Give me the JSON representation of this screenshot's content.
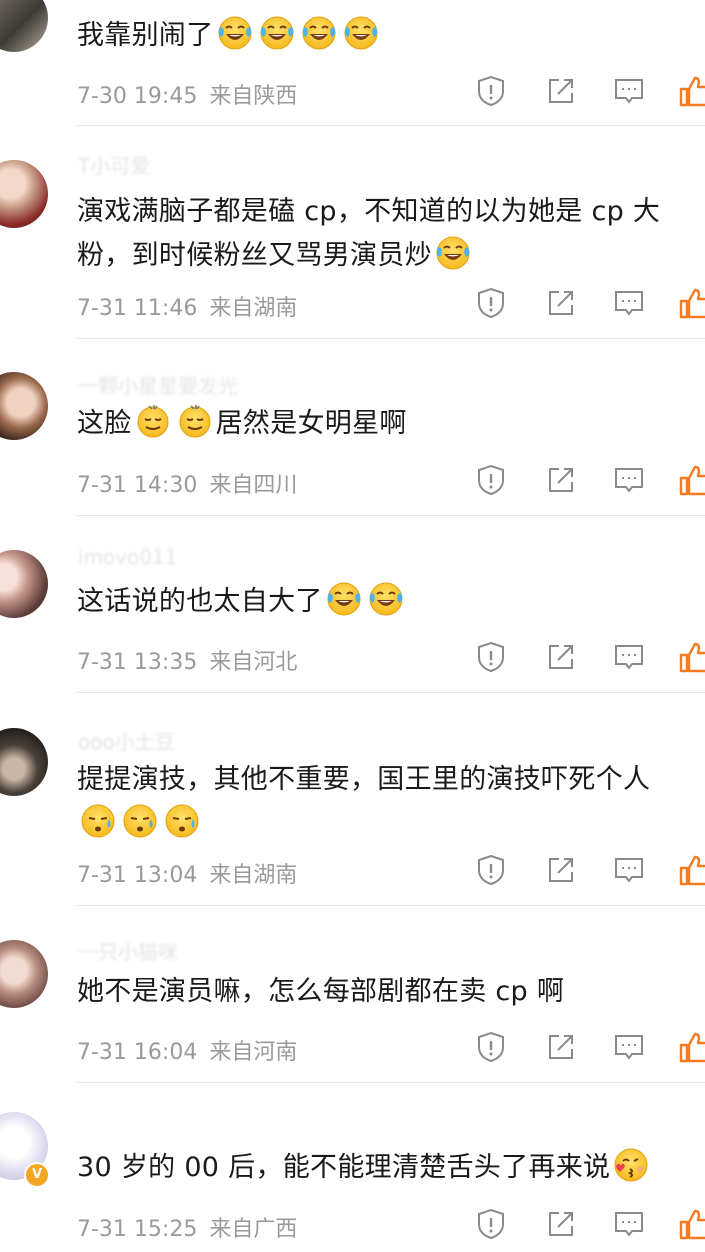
{
  "comments": [
    {
      "username": "",
      "text": "我靠别闹了",
      "emojis_after": [
        "laugh-cry",
        "laugh-cry",
        "laugh-cry",
        "laugh-cry"
      ],
      "date": "7-30 19:45",
      "location": "来自陕西"
    },
    {
      "username": "T小可爱",
      "text1": "演戏满脑子都是磕 cp，不知道的以为她是 cp 大",
      "text2": "粉，到时候粉丝又骂男演员炒",
      "emojis_after": [
        "laugh-cry"
      ],
      "date": "7-31 11:46",
      "location": "来自湖南"
    },
    {
      "username": "一颗小星星要发光",
      "text_before": "这脸",
      "emojis_mid": [
        "dizzy",
        "dizzy"
      ],
      "text_after": "居然是女明星啊",
      "date": "7-31 14:30",
      "location": "来自四川"
    },
    {
      "username": "imovo011",
      "text": "这话说的也太自大了",
      "emojis_after": [
        "laugh-cry",
        "laugh-cry"
      ],
      "date": "7-31 13:35",
      "location": "来自河北"
    },
    {
      "username": "ooo小土豆",
      "text1": "提提演技，其他不重要，国王里的演技吓死个人",
      "emojis_line2": [
        "sweat",
        "sweat",
        "sweat"
      ],
      "date": "7-31 13:04",
      "location": "来自湖南"
    },
    {
      "username": "一只小猫咪",
      "text": "她不是演员嘛，怎么每部剧都在卖 cp 啊",
      "date": "7-31 16:04",
      "location": "来自河南"
    },
    {
      "username": "",
      "text": "30 岁的 00 后，能不能理清楚舌头了再来说",
      "emojis_after": [
        "kiss"
      ],
      "date": "7-31 15:25",
      "location": "来自广西"
    }
  ],
  "icons": {
    "report": "report-icon",
    "repost": "repost-icon",
    "reply": "comment-icon",
    "like": "like-icon"
  },
  "colors": {
    "like": "#f47b20",
    "meta": "#9a9a9a",
    "text": "#1a1a1a"
  }
}
